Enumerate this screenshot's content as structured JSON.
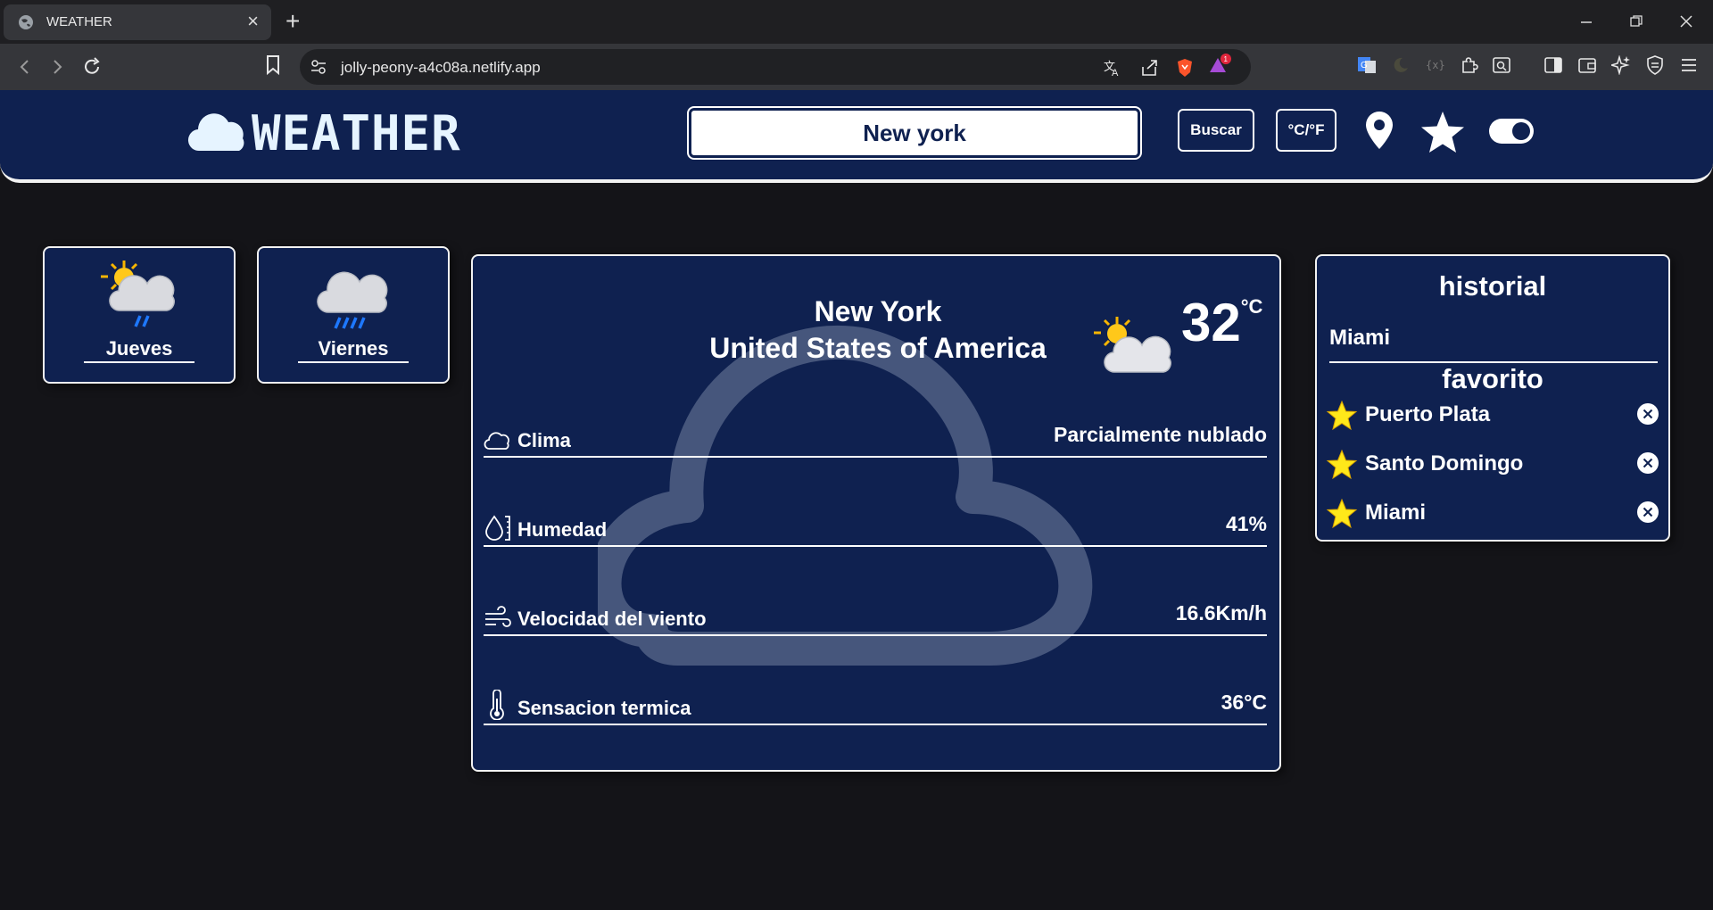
{
  "browser": {
    "tab_title": "WEATHER",
    "tab_close": "×",
    "new_tab": "+",
    "url": "jolly-peony-a4c08a.netlify.app",
    "window_controls": [
      "minimize",
      "restore",
      "close"
    ]
  },
  "app": {
    "logo_text": "WEATHER",
    "search": {
      "value": "New york",
      "placeholder": ""
    },
    "search_button": "Buscar",
    "unit_button": "°C/°F",
    "icons": [
      "location-pin-icon",
      "star-icon",
      "toggle-icon"
    ]
  },
  "forecast": [
    {
      "day": "Jueves",
      "icon": "sun-cloud-rain-icon"
    },
    {
      "day": "Viernes",
      "icon": "cloud-heavy-rain-icon"
    }
  ],
  "current": {
    "city": "New York",
    "country": "United States of America",
    "temp": "32",
    "unit": "°C",
    "icon": "partly-cloudy-icon",
    "rows": [
      {
        "label": "Clima",
        "value": "Parcialmente nublado",
        "icon": "cloud-outline-icon"
      },
      {
        "label": "Humedad",
        "value": "41%",
        "icon": "humidity-icon"
      },
      {
        "label": "Velocidad del viento",
        "value": "16.6Km/h",
        "icon": "wind-icon"
      },
      {
        "label": "Sensacion termica",
        "value": "36°C",
        "icon": "thermometer-icon"
      }
    ]
  },
  "sidebar": {
    "history_title": "historial",
    "history": [
      "Miami"
    ],
    "favorites_title": "favorito",
    "favorites": [
      "Puerto Plata",
      "Santo Domingo",
      "Miami"
    ]
  },
  "colors": {
    "navy": "#0f2150",
    "page_bg": "#141418",
    "star": "#ffe81a"
  }
}
